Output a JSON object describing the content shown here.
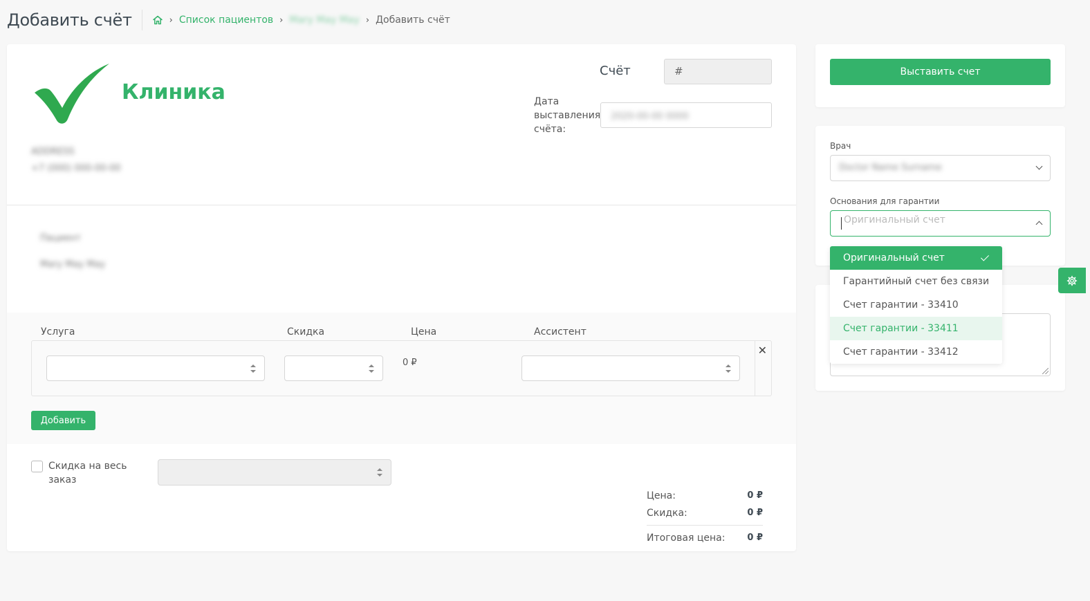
{
  "header": {
    "title": "Добавить счёт",
    "breadcrumb": {
      "patients_link": "Список пациентов",
      "patient_name": "Mary May May",
      "current": "Добавить счёт"
    }
  },
  "invoice": {
    "clinic_name": "Клиника",
    "clinic_address": "ADDRESS",
    "clinic_phone": "+7 (000) 000-00-00",
    "invoice_label": "Счёт",
    "invoice_number": "#",
    "date_label": "Дата выставления счёта:",
    "date_value": "2020-00-00 0000",
    "patient_label": "Пациент",
    "patient_name": "Mary May May"
  },
  "services": {
    "col_service": "Услуга",
    "col_discount": "Скидка",
    "col_price": "Цена",
    "col_assistant": "Ассистент",
    "row_price": "0 ₽",
    "close_symbol": "✕",
    "add_label": "Добавить"
  },
  "order_discount": {
    "label": "Скидка на весь заказ"
  },
  "totals": {
    "price_label": "Цена:",
    "price_value": "0 ₽",
    "discount_label": "Скидка:",
    "discount_value": "0 ₽",
    "total_label": "Итоговая цена:",
    "total_value": "0 ₽"
  },
  "sidebar": {
    "issue_button": "Выставить счет",
    "doctor_label": "Врач",
    "doctor_value": "Doctor Name Surname",
    "basis_label": "Основания для гарантии",
    "basis_placeholder": "Оригинальный счет",
    "basis_options": [
      "Оригинальный счет",
      "Гарантийный счет без связи",
      "Счет гарантии - 33410",
      "Счет гарантии - 33411",
      "Счет гарантии - 33412"
    ]
  },
  "colors": {
    "accent": "#34b36b",
    "hover": "#e8f6ee"
  },
  "icons": [
    "home-icon",
    "chevron-right-icon",
    "checkmark-logo-icon",
    "close-icon",
    "chevron-down-icon",
    "chevron-up-icon",
    "check-icon",
    "gear-icon"
  ]
}
